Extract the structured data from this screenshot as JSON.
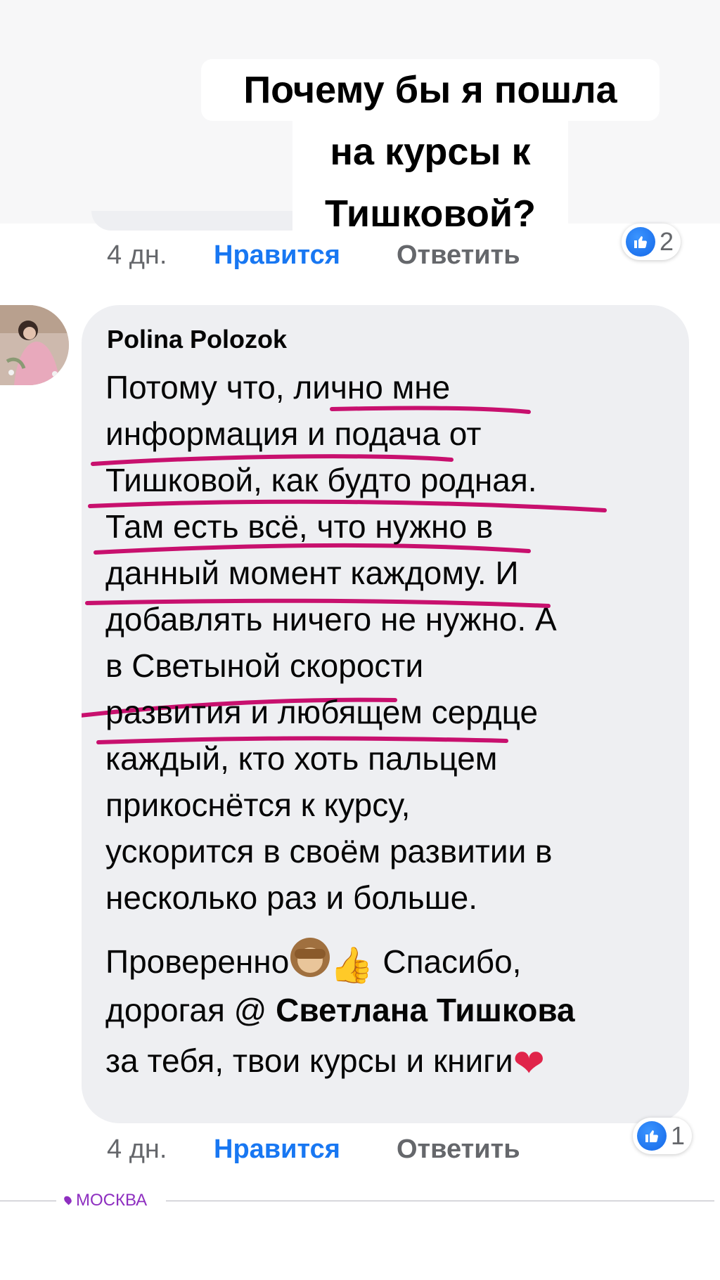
{
  "story_title": {
    "line1": "Почему бы я пошла",
    "line2": "на курсы к",
    "line3": "Тишковой?"
  },
  "previous_comment": {
    "time": "4 дн.",
    "like_label": "Нравится",
    "reply_label": "Ответить",
    "reaction_count": "2"
  },
  "comment": {
    "author": "Polina Polozok",
    "lines": [
      "Потому что, лично мне",
      "информация и подача от",
      "Тишковой, как будто родная.",
      "Там есть всё, что нужно в",
      "данный момент каждому. И",
      "добавлять ничего не нужно. А",
      "в Светыной скорости",
      "развития и любящем сердце",
      "каждый, кто хоть пальцем",
      "прикоснётся к курсу,",
      "ускорится в своём развитии в",
      "несколько раз и больше."
    ],
    "line13_text": "Проверенно",
    "line13_tail": " Спасибо,",
    "line14_prefix": "дорогая @ ",
    "mention": "Светлана Тишкова",
    "line15_text": "за тебя, твои курсы и книги",
    "time": "4 дн.",
    "like_label": "Нравится",
    "reply_label": "Ответить",
    "reaction_count": "1"
  },
  "icons": {
    "like_reaction": "thumbs-up-icon",
    "emoji_1": "see-no-evil-monkey-icon",
    "emoji_2": "thumbs-up-emoji-icon",
    "emoji_3": "two-hearts-icon",
    "location": "location-pin-icon"
  },
  "location_label": "МОСКВА",
  "colors": {
    "accent_blue": "#1877f2",
    "underline_magenta": "#c8106e",
    "location_purple": "#8e2fc0",
    "bubble_bg": "#eeeff2"
  }
}
